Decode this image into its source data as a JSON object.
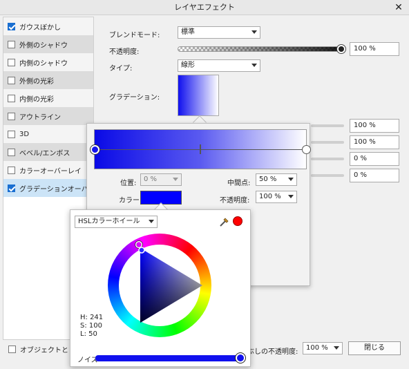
{
  "window": {
    "title": "レイヤエフェクト",
    "close": "✕"
  },
  "sidebar": {
    "items": [
      {
        "label": "ガウスぼかし",
        "checked": true
      },
      {
        "label": "外側のシャドウ",
        "checked": false
      },
      {
        "label": "内側のシャドウ",
        "checked": false
      },
      {
        "label": "外側の光彩",
        "checked": false
      },
      {
        "label": "内側の光彩",
        "checked": false
      },
      {
        "label": "アウトライン",
        "checked": false
      },
      {
        "label": "3D",
        "checked": false
      },
      {
        "label": "ベベル/エンボス",
        "checked": false
      },
      {
        "label": "カラーオーバーレイ",
        "checked": false
      },
      {
        "label": "グラデーションオーバーレイ",
        "checked": true
      }
    ]
  },
  "main": {
    "blend_mode_label": "ブレンドモード:",
    "blend_mode_value": "標準",
    "opacity_label": "不透明度:",
    "opacity_value": "100 %",
    "type_label": "タイプ:",
    "type_value": "線形",
    "gradient_label": "グラデーション:",
    "hidden_fields": [
      "100 %",
      "100 %",
      "0 %",
      "0 %"
    ]
  },
  "gradient_popup": {
    "position_label": "位置:",
    "position_value": "0 %",
    "midpoint_label": "中間点:",
    "midpoint_value": "50 %",
    "color_label": "カラー:",
    "opacity_label": "不透明度:",
    "opacity_value": "100 %",
    "stop_color": "#0000ff"
  },
  "color_picker": {
    "mode": "HSLカラーホイール",
    "h": "H: 241",
    "s": "S: 100",
    "l": "L: 50",
    "noise_label": "ノイズ",
    "current_color": "#ff0000"
  },
  "footer": {
    "object_checkbox_label": "オブジェクトととも",
    "fill_opacity_label": "ぶしの不透明度:",
    "fill_opacity_value": "100 %",
    "close_button": "閉じる"
  }
}
